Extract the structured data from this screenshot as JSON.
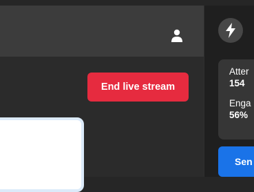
{
  "header": {
    "user_icon": "user-icon"
  },
  "main": {
    "end_button_label": "End live stream"
  },
  "sidebar": {
    "bolt_icon": "bolt-icon",
    "stats": [
      {
        "label": "Atter",
        "value": "154"
      },
      {
        "label": "Enga",
        "value": "56%"
      }
    ],
    "send_label": "Sen"
  },
  "colors": {
    "end_button": "#e62b3f",
    "send_button": "#1a73e8",
    "topbar": "#3c3c3c",
    "sidebar": "#1f1f1f"
  }
}
